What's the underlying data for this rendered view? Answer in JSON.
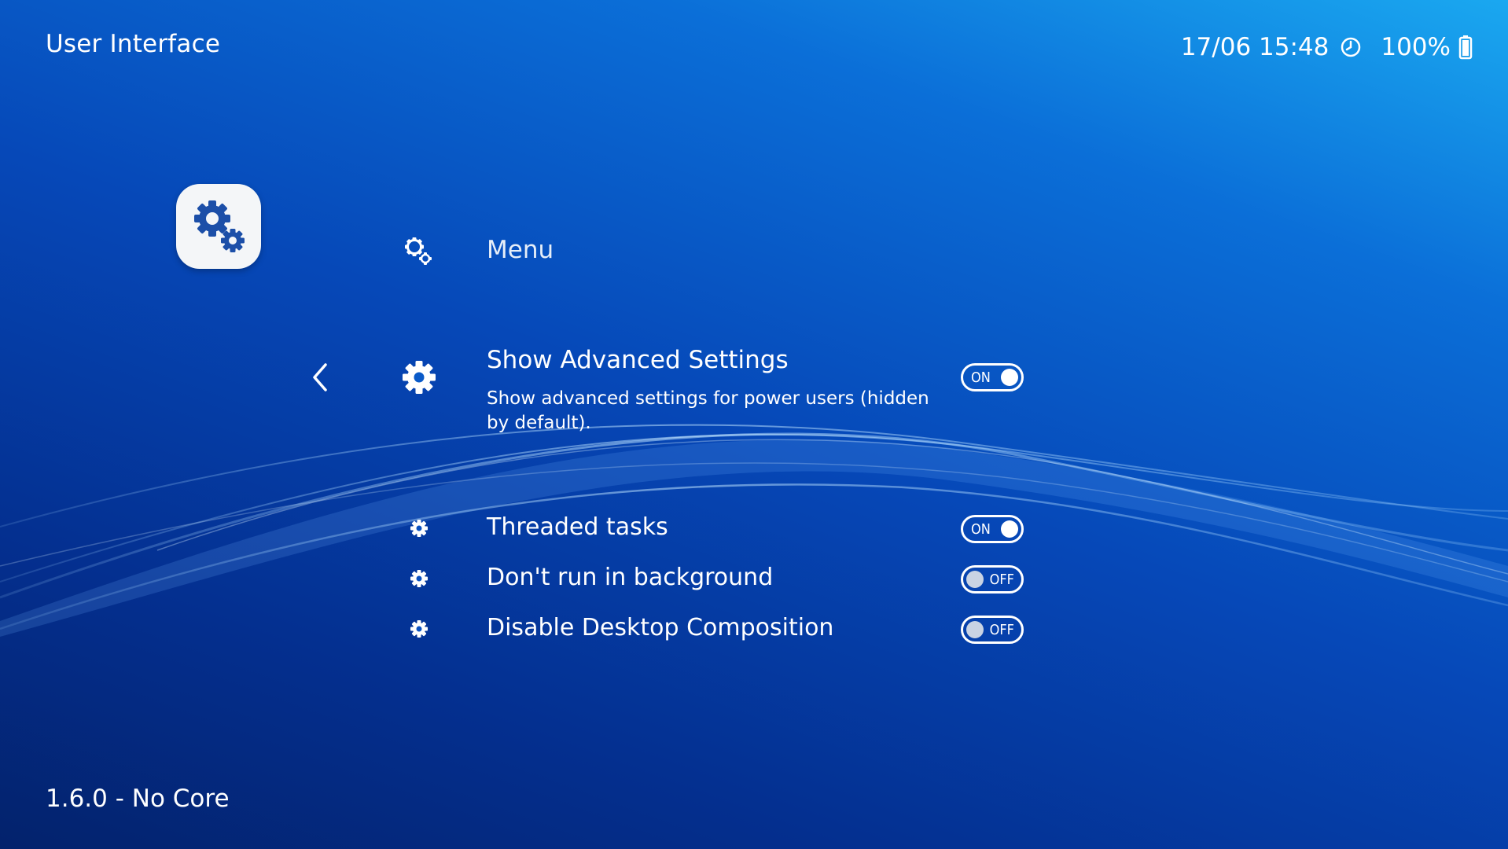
{
  "header": {
    "title": "User Interface",
    "datetime": "17/06 15:48",
    "battery": "100%"
  },
  "footer": {
    "version": "1.6.0 - No Core"
  },
  "category": {
    "icon": "settings-gears-icon"
  },
  "menu": {
    "items": [
      {
        "label": "Menu",
        "icon": "gears-icon"
      },
      {
        "label": "Show Advanced Settings",
        "description": "Show advanced settings for power users (hidden by default).",
        "toggle": "ON",
        "icon": "gear-icon",
        "selected": true
      },
      {
        "label": "Threaded tasks",
        "toggle": "ON",
        "icon": "gear-small-icon"
      },
      {
        "label": "Don't run in background",
        "toggle": "OFF",
        "icon": "gear-small-icon"
      },
      {
        "label": "Disable Desktop Composition",
        "toggle": "OFF",
        "icon": "gear-small-icon"
      }
    ]
  },
  "colors": {
    "background_top": "#1aa8f0",
    "background_mid": "#0648b8",
    "background_bottom": "#03226c",
    "text": "#ffffff",
    "icon_accent": "#1c4fa8"
  }
}
